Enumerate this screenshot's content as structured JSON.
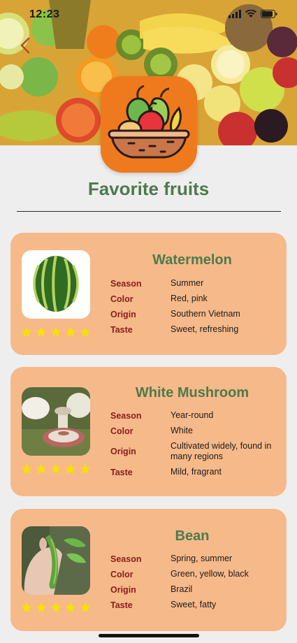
{
  "status_bar": {
    "time": "12:23"
  },
  "header": {
    "title": "Favorite fruits"
  },
  "icons": {
    "back": "chevron-left-icon",
    "app": "fruit-basket-icon",
    "star": "star-icon",
    "signal": "signal-icon",
    "wifi": "wifi-icon",
    "battery": "battery-icon"
  },
  "colors": {
    "background": "#efeeef",
    "card": "#f6b98a",
    "title_green": "#4d7a4e",
    "label_red": "#8a1c1c",
    "app_icon": "#ef7a1d",
    "star": "#f7e100"
  },
  "labels": {
    "season": "Season",
    "color": "Color",
    "origin": "Origin",
    "taste": "Taste"
  },
  "fruits": [
    {
      "name": "Watermelon",
      "season": "Summer",
      "color": "Red, pink",
      "origin": "Southern Vietnam",
      "taste": "Sweet, refreshing",
      "rating": 5
    },
    {
      "name": "White Mushroom",
      "season": "Year-round",
      "color": "White",
      "origin": "Cultivated widely, found in many regions",
      "taste": "Mild, fragrant",
      "rating": 5
    },
    {
      "name": "Bean",
      "season": "Spring, summer",
      "color": "Green, yellow, black",
      "origin": "Brazil",
      "taste": "Sweet, fatty",
      "rating": 5
    }
  ]
}
